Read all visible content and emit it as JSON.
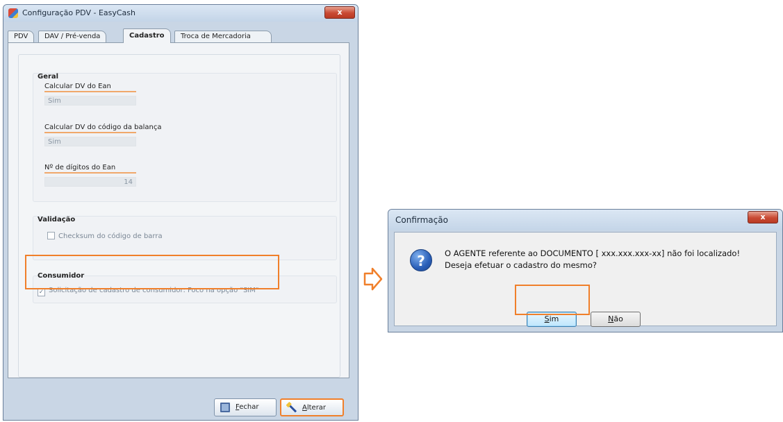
{
  "config_window": {
    "title": "Configuração PDV - EasyCash",
    "close_label": "x",
    "tabs": [
      {
        "label": "PDV"
      },
      {
        "label": "DAV / Pré-venda"
      },
      {
        "label": "Cadastro",
        "active": true
      },
      {
        "label": "Troca de Mercadoria"
      }
    ],
    "geral": {
      "title": "Geral",
      "fields": [
        {
          "label": "Calcular DV do Ean",
          "value": "Sim"
        },
        {
          "label": "Calcular DV do código da balança",
          "value": "Sim"
        },
        {
          "label": "Nº de dígitos do Ean",
          "value": "14"
        }
      ]
    },
    "validacao": {
      "title": "Validação",
      "checkbox_label": "Checksum do código de barra",
      "checked": false
    },
    "consumidor": {
      "title": "Consumidor",
      "checkbox_label": "Solicitação de cadastro de consumidor: Foco na opção \"SIM\"",
      "checked": true
    },
    "buttons": {
      "fechar_first": "F",
      "fechar_rest": "echar",
      "alterar_first": "A",
      "alterar_rest": "lterar"
    }
  },
  "highlight_color": "#f07f2a",
  "dialog": {
    "title": "Confirmação",
    "close_label": "x",
    "icon": "question-icon",
    "message_line1": "O AGENTE referente ao DOCUMENTO [ xxx.xxx.xxx-xx] não foi localizado!",
    "message_line2": "Deseja efetuar o cadastro do mesmo?",
    "sim_first": "S",
    "sim_rest": "im",
    "nao_first": "N",
    "nao_rest": "ão"
  }
}
